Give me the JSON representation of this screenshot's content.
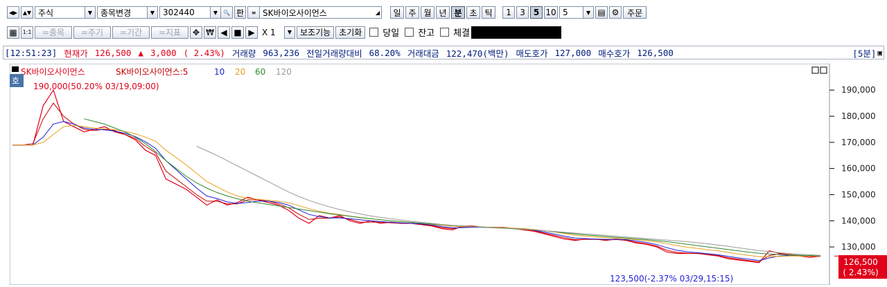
{
  "toolbar": {
    "market_select": "주식",
    "change_item_label": "종목변경",
    "code_value": "302440",
    "ban_label": "판",
    "name_value": "SK바이오사이언스",
    "period_tabs": [
      "일",
      "주",
      "월",
      "년",
      "분",
      "초",
      "틱"
    ],
    "period_selected": "분",
    "interval_buttons": [
      "1",
      "3",
      "5",
      "10"
    ],
    "interval_selected": "5",
    "interval_value": "5",
    "order_label": "주문",
    "row2_buttons": [
      "=종목",
      "=주기",
      "=기간",
      "=지표"
    ],
    "multiplier_label": "X 1",
    "aux_label": "보조기능",
    "reset_label": "초기화",
    "checkbox_today": "당일",
    "checkbox_balance": "잔고",
    "checkbox_fill": "체결"
  },
  "info": {
    "time": "[12:51:23]",
    "price_label": "현재가",
    "price": "126,500",
    "change_arrow": "▲",
    "change": "3,000",
    "change_pct": "( 2.43%)",
    "volume_label": "거래량",
    "volume": "963,236",
    "prev_ratio_label": "전일거래량대비",
    "prev_ratio": "68.20%",
    "value_label": "거래대금",
    "value": "122,470(백만)",
    "ask_label": "매도호가",
    "ask": "127,000",
    "bid_label": "매수호가",
    "bid": "126,500",
    "interval_tag": "[5분]"
  },
  "legend": {
    "series_name": "SK바이오사이언스",
    "ma_name": "SK바이오사이언스:5",
    "ma_periods": [
      "10",
      "20",
      "60",
      "120"
    ],
    "ma_colors": [
      "#1f1fd8",
      "#e8a020",
      "#2f8a2f",
      "#9a9a9a"
    ]
  },
  "colors": {
    "up": "#e0001b",
    "down": "#1f1fd8",
    "ma5": "#c80000",
    "ma10": "#1f1fd8",
    "ma20": "#e8a020",
    "ma60": "#2f8a2f",
    "ma120": "#9a9a9a"
  },
  "annotations": {
    "high": "190,000(50.20% 03/19,09:00)",
    "low": "123,500(-2.37% 03/29,15:15)",
    "current_price": "126,500",
    "current_pct": "( 2.43%)"
  },
  "chart_data": {
    "type": "line",
    "title": "",
    "ylim": [
      116000,
      198000
    ],
    "yticks": [
      130000,
      140000,
      150000,
      160000,
      170000,
      180000,
      190000
    ],
    "ytick_labels": [
      "130,000",
      "140,000",
      "150,000",
      "160,000",
      "170,000",
      "180,000",
      "190,000"
    ],
    "series": [
      {
        "name": "SK바이오사이언스",
        "values": [
          169000,
          169000,
          169000,
          184000,
          190000,
          178000,
          176000,
          174000,
          175000,
          176000,
          174000,
          173000,
          171000,
          167000,
          165000,
          156000,
          154000,
          152000,
          149000,
          146000,
          148000,
          146000,
          147000,
          149000,
          148000,
          147000,
          146000,
          144000,
          141000,
          139000,
          142000,
          141000,
          142000,
          140000,
          139000,
          140000,
          139000,
          139500,
          139000,
          139000,
          138500,
          138000,
          137000,
          136500,
          138000,
          138000,
          137500,
          137500,
          137500,
          137000,
          136500,
          136000,
          135000,
          134000,
          133000,
          132500,
          133000,
          133000,
          132500,
          133000,
          132500,
          131500,
          131000,
          130000,
          128000,
          127500,
          127500,
          127500,
          127000,
          126500,
          125500,
          125000,
          124500,
          124000,
          128500,
          127500,
          127000,
          126500,
          126000,
          126500
        ]
      },
      {
        "name": "5",
        "values": [
          169000,
          169000,
          169500,
          179000,
          185000,
          180000,
          177000,
          175000,
          174500,
          175000,
          174500,
          173000,
          171500,
          168500,
          166000,
          159000,
          156000,
          153000,
          150000,
          147500,
          147500,
          146500,
          146500,
          148000,
          148000,
          147500,
          146500,
          145000,
          142500,
          140500,
          141000,
          141000,
          141500,
          140500,
          139500,
          139500,
          139500,
          139200,
          139000,
          139000,
          138600,
          138200,
          137400,
          137000,
          137600,
          137800,
          137600,
          137400,
          137400,
          137100,
          136700,
          136200,
          135300,
          134400,
          133500,
          132800,
          132900,
          132900,
          132700,
          132800,
          132600,
          131800,
          131200,
          130300,
          128700,
          127900,
          127600,
          127500,
          127100,
          126700,
          125900,
          125300,
          124800,
          124300,
          126700,
          127300,
          127100,
          126800,
          126400,
          126400
        ]
      },
      {
        "name": "10",
        "values": [
          169000,
          169000,
          169000,
          172000,
          177000,
          178000,
          177000,
          175500,
          175000,
          174800,
          174300,
          173500,
          172200,
          170200,
          167700,
          163000,
          159500,
          156000,
          152500,
          149500,
          148500,
          147200,
          146600,
          147000,
          147500,
          147500,
          147000,
          146000,
          144200,
          142400,
          141600,
          141100,
          141100,
          140800,
          140400,
          140000,
          139700,
          139400,
          139200,
          139000,
          138800,
          138400,
          137800,
          137300,
          137400,
          137500,
          137500,
          137400,
          137300,
          137100,
          136800,
          136400,
          135700,
          134900,
          134100,
          133400,
          133200,
          133000,
          132900,
          132900,
          132800,
          132300,
          131700,
          130900,
          129700,
          128700,
          128100,
          127800,
          127400,
          127000,
          126400,
          125800,
          125300,
          124800,
          125800,
          126500,
          126800,
          126800,
          126600,
          126500
        ]
      },
      {
        "name": "20",
        "values": [
          169000,
          169000,
          169000,
          170000,
          173000,
          176000,
          176500,
          176000,
          175500,
          175200,
          174800,
          174200,
          173300,
          172000,
          170400,
          167000,
          164200,
          161300,
          158200,
          155000,
          153000,
          151000,
          149500,
          148600,
          148200,
          147900,
          147500,
          146900,
          145800,
          144600,
          143700,
          142900,
          142400,
          141800,
          141300,
          140800,
          140400,
          140000,
          139700,
          139400,
          139100,
          138700,
          138300,
          137900,
          137800,
          137700,
          137600,
          137500,
          137400,
          137200,
          137000,
          136700,
          136200,
          135700,
          135100,
          134500,
          134100,
          133800,
          133500,
          133300,
          133100,
          132800,
          132400,
          131900,
          131200,
          130500,
          129900,
          129400,
          128900,
          128500,
          127900,
          127300,
          126800,
          126300,
          126300,
          126400,
          126500,
          126500,
          126500,
          126500
        ]
      },
      {
        "name": "60",
        "values": [
          null,
          null,
          null,
          null,
          null,
          null,
          null,
          179000,
          178000,
          177000,
          175500,
          174000,
          172000,
          169500,
          166500,
          163000,
          160000,
          157000,
          154500,
          152500,
          150800,
          149500,
          148400,
          147500,
          146900,
          146300,
          145700,
          145100,
          144500,
          143900,
          143300,
          142700,
          142200,
          141700,
          141200,
          140800,
          140400,
          140000,
          139700,
          139400,
          139100,
          138800,
          138500,
          138200,
          138000,
          137800,
          137600,
          137400,
          137200,
          137000,
          136800,
          136500,
          136200,
          135800,
          135400,
          135000,
          134600,
          134300,
          134000,
          133700,
          133400,
          133100,
          132800,
          132400,
          132000,
          131500,
          131000,
          130500,
          130000,
          129500,
          129000,
          128500,
          128000,
          127600,
          127300,
          127100,
          126900,
          126800,
          126700,
          126600
        ]
      },
      {
        "name": "120",
        "values": [
          null,
          null,
          null,
          null,
          null,
          null,
          null,
          null,
          null,
          null,
          null,
          null,
          null,
          null,
          null,
          null,
          null,
          null,
          168500,
          166800,
          165000,
          163000,
          161000,
          159000,
          157000,
          155000,
          153000,
          151000,
          149300,
          147800,
          146500,
          145300,
          144300,
          143400,
          142600,
          141900,
          141300,
          140800,
          140300,
          139800,
          139400,
          139000,
          138600,
          138300,
          138000,
          137700,
          137500,
          137300,
          137100,
          136900,
          136700,
          136500,
          136200,
          135900,
          135600,
          135300,
          135000,
          134700,
          134400,
          134100,
          133800,
          133500,
          133200,
          132900,
          132600,
          132300,
          132000,
          131600,
          131200,
          130700,
          130200,
          129700,
          129100,
          128600,
          128200,
          127800,
          127500,
          127200,
          127000,
          126800
        ]
      }
    ]
  }
}
